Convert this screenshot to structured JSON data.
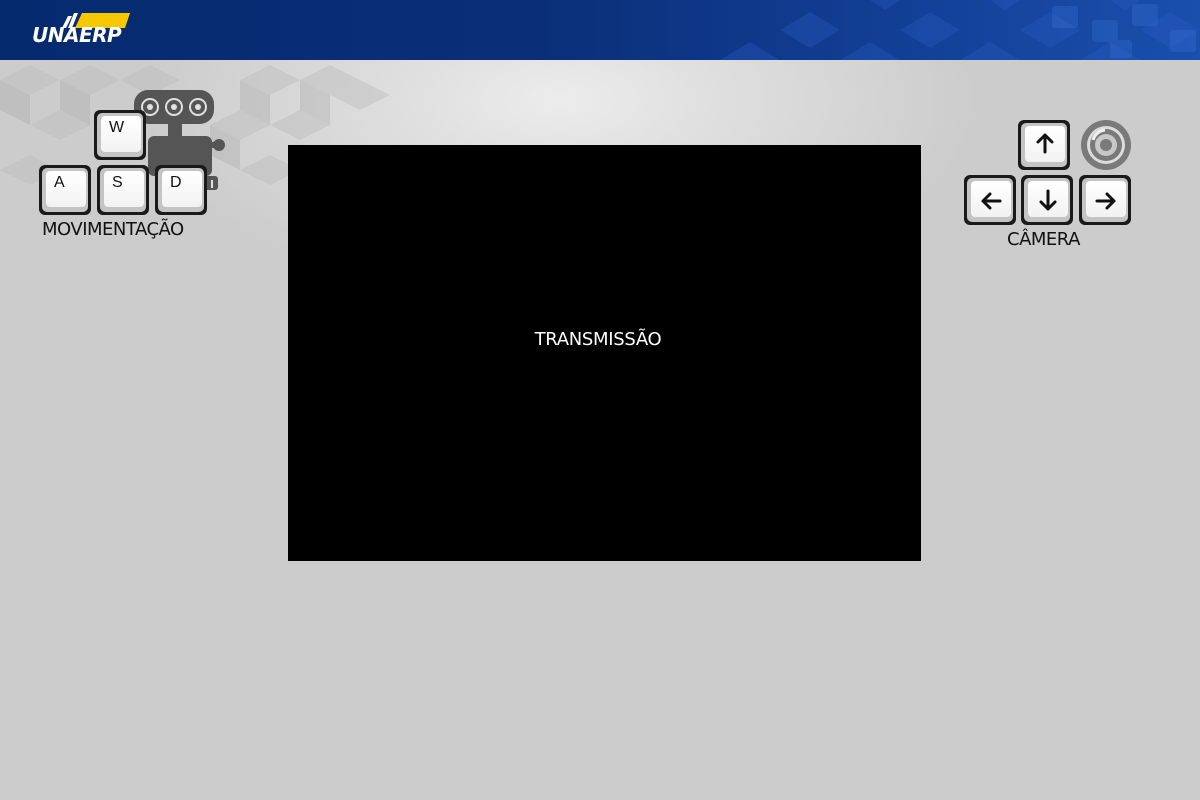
{
  "header": {
    "logo_text": "UNAERP",
    "background_color": "#0a2f78",
    "logo_accent_color": "#f5c800"
  },
  "movement": {
    "keys": {
      "w": "W",
      "a": "A",
      "s": "S",
      "d": "D"
    },
    "label": "MOVIMENTAÇÃO",
    "icon": "robot-icon"
  },
  "camera": {
    "keys": [
      "arrow-up",
      "arrow-left",
      "arrow-down",
      "arrow-right"
    ],
    "label": "CÂMERA",
    "icon": "camera-lens-icon"
  },
  "stream": {
    "label": "TRANSMISSÃO",
    "background_color": "#000000"
  }
}
